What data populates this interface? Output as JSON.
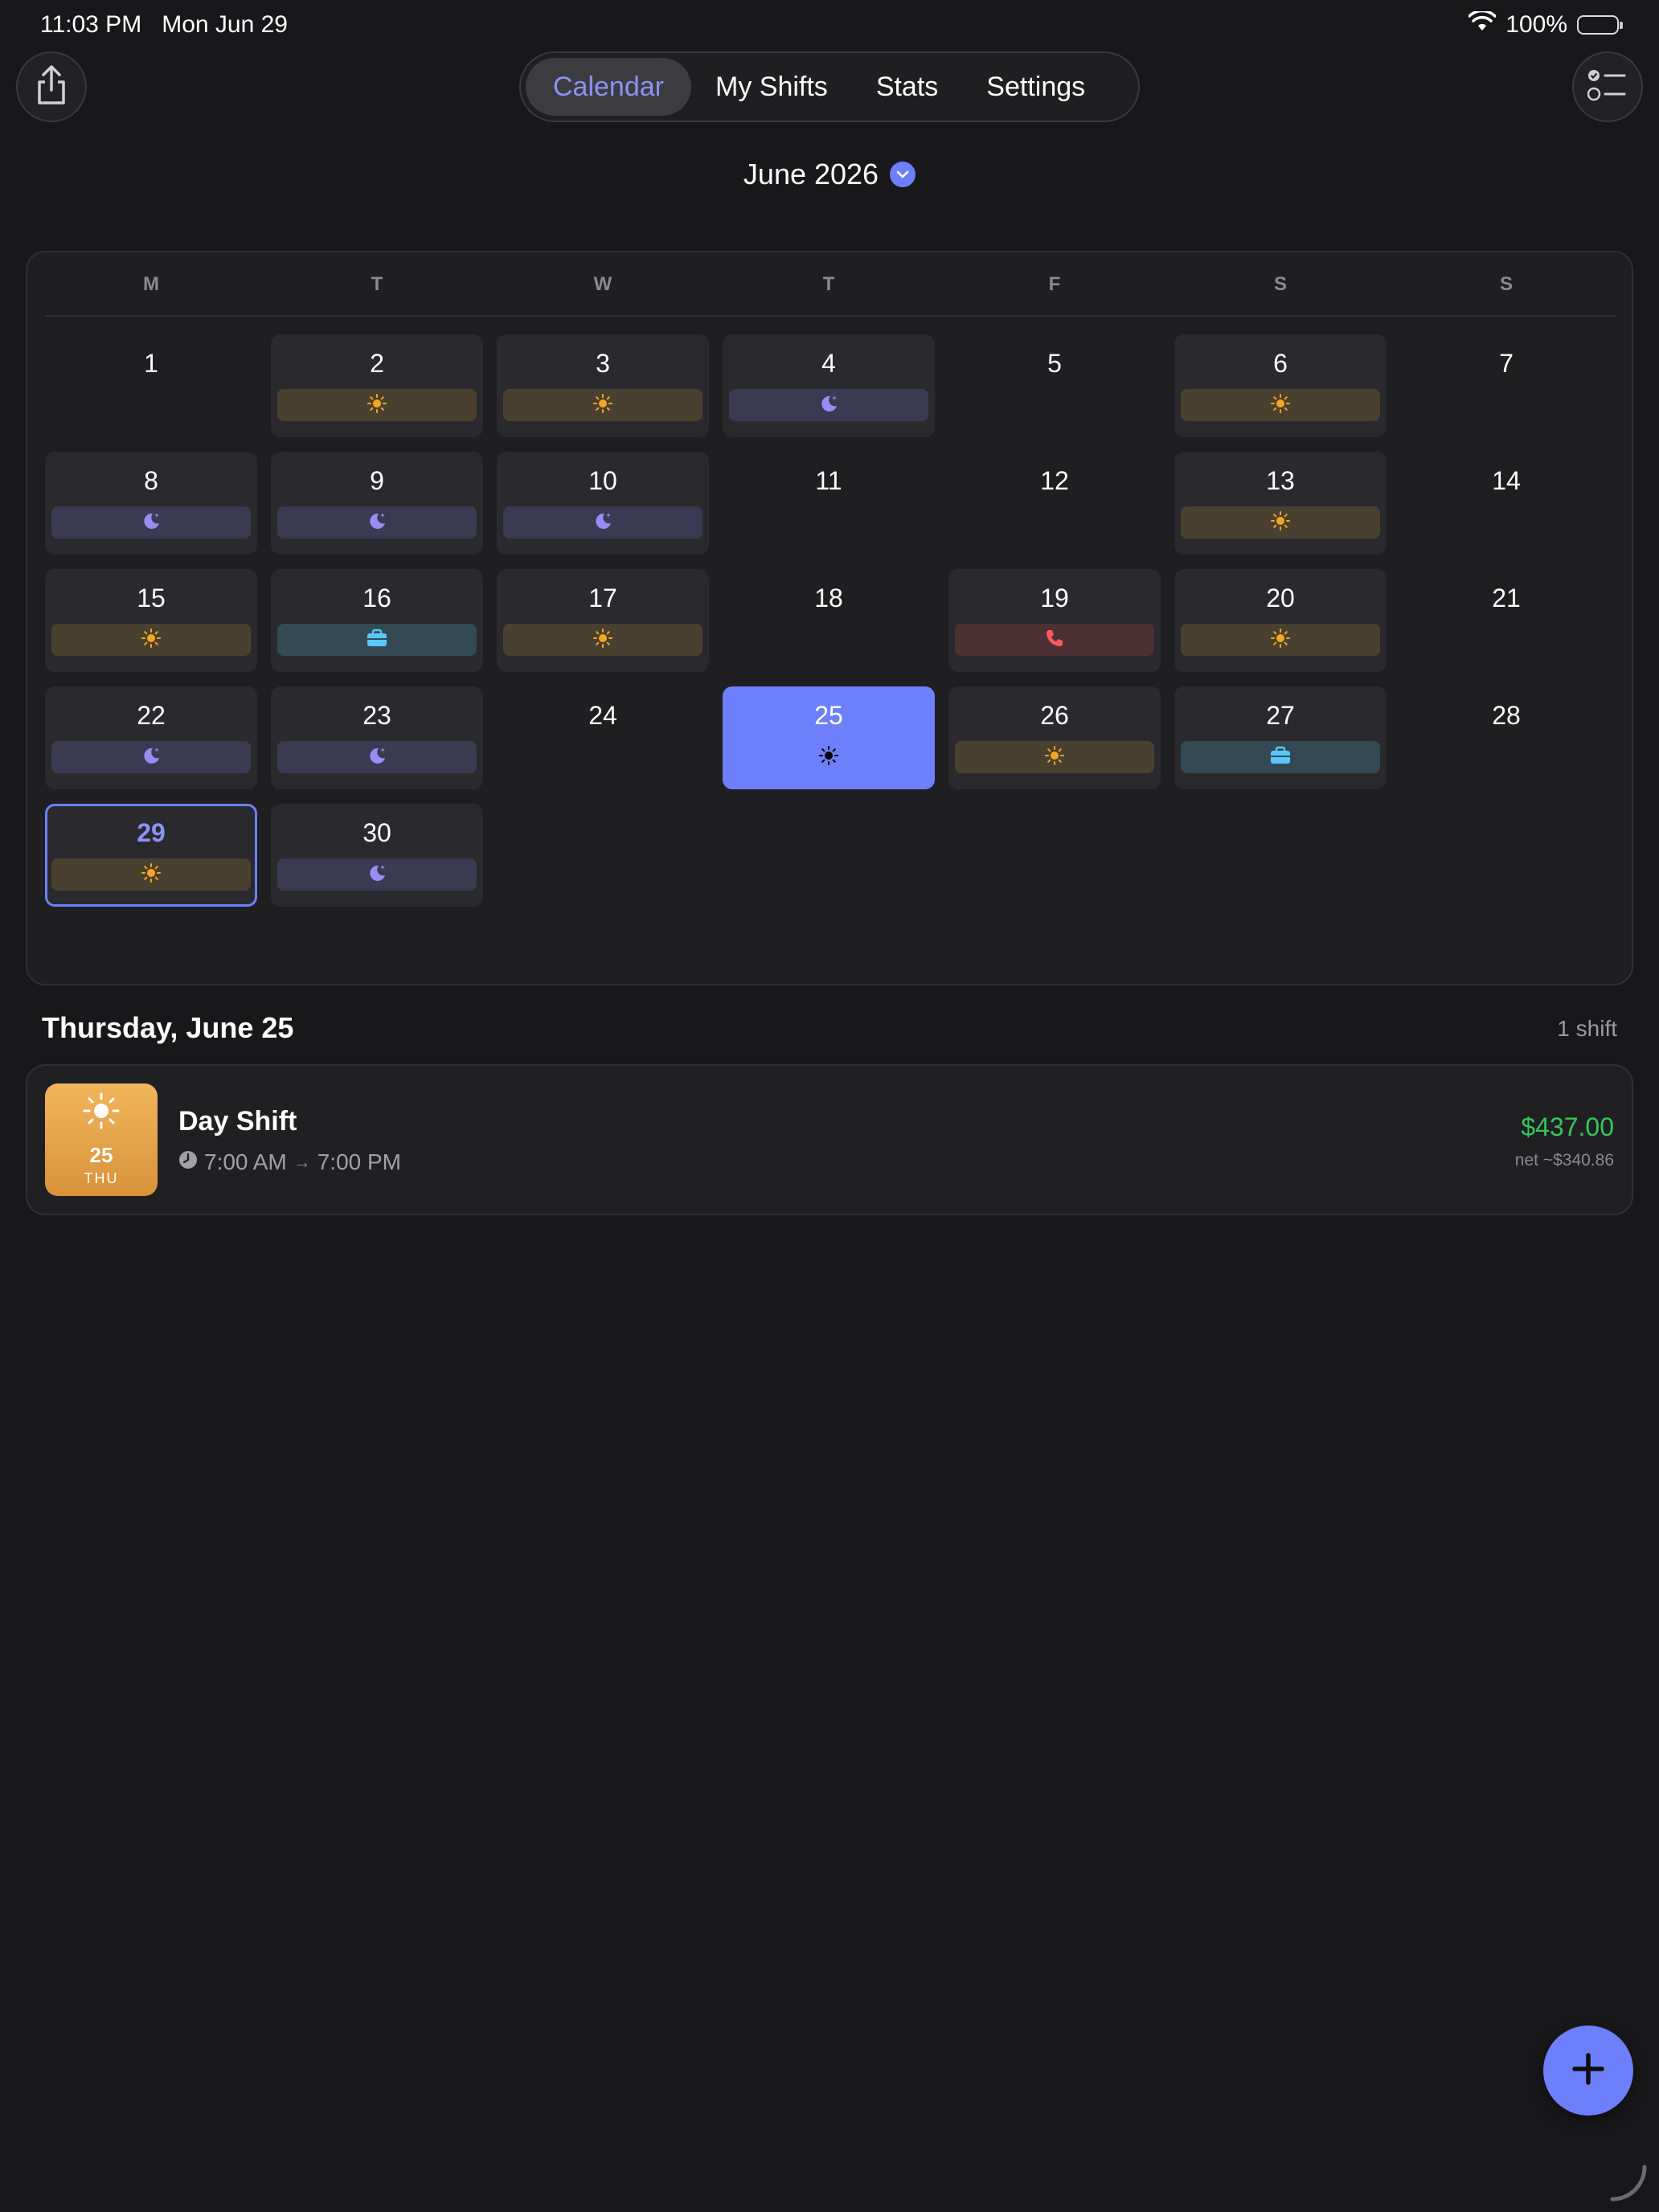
{
  "status": {
    "time": "11:03 PM",
    "date": "Mon Jun 29",
    "battery": "100%"
  },
  "nav": {
    "tabs": [
      {
        "label": "Calendar",
        "active": true
      },
      {
        "label": "My Shifts",
        "active": false
      },
      {
        "label": "Stats",
        "active": false
      },
      {
        "label": "Settings",
        "active": false
      }
    ]
  },
  "month": {
    "label": "June 2026"
  },
  "calendar": {
    "weekdays": [
      "M",
      "T",
      "W",
      "T",
      "F",
      "S",
      "S"
    ],
    "days": [
      {
        "day": "1",
        "shift": null
      },
      {
        "day": "2",
        "shift": "day"
      },
      {
        "day": "3",
        "shift": "day"
      },
      {
        "day": "4",
        "shift": "night"
      },
      {
        "day": "5",
        "shift": null
      },
      {
        "day": "6",
        "shift": "day"
      },
      {
        "day": "7",
        "shift": null
      },
      {
        "day": "8",
        "shift": "night"
      },
      {
        "day": "9",
        "shift": "night"
      },
      {
        "day": "10",
        "shift": "night"
      },
      {
        "day": "11",
        "shift": null
      },
      {
        "day": "12",
        "shift": null
      },
      {
        "day": "13",
        "shift": "day"
      },
      {
        "day": "14",
        "shift": null
      },
      {
        "day": "15",
        "shift": "day"
      },
      {
        "day": "16",
        "shift": "work"
      },
      {
        "day": "17",
        "shift": "day"
      },
      {
        "day": "18",
        "shift": null
      },
      {
        "day": "19",
        "shift": "call"
      },
      {
        "day": "20",
        "shift": "day"
      },
      {
        "day": "21",
        "shift": null
      },
      {
        "day": "22",
        "shift": "night"
      },
      {
        "day": "23",
        "shift": "night"
      },
      {
        "day": "24",
        "shift": null
      },
      {
        "day": "25",
        "shift": "day",
        "selected": true
      },
      {
        "day": "26",
        "shift": "day"
      },
      {
        "day": "27",
        "shift": "work"
      },
      {
        "day": "28",
        "shift": null
      },
      {
        "day": "29",
        "shift": "day",
        "today": true
      },
      {
        "day": "30",
        "shift": "night"
      }
    ],
    "colors": {
      "accent": "#6e7ffb",
      "day_icon": "#f5a623",
      "night_icon": "#9a8cf5",
      "work_icon": "#5ac8fa",
      "call_icon": "#ff5a5f"
    }
  },
  "detail": {
    "title": "Thursday, June 25",
    "count": "1 shift",
    "shift": {
      "badge_icon": "sun-icon",
      "badge_date": "25",
      "badge_weekday": "THU",
      "name": "Day Shift",
      "start": "7:00 AM",
      "arrow": "→",
      "end": "7:00 PM",
      "pay": "$437.00",
      "net": "net ~$340.86"
    }
  }
}
